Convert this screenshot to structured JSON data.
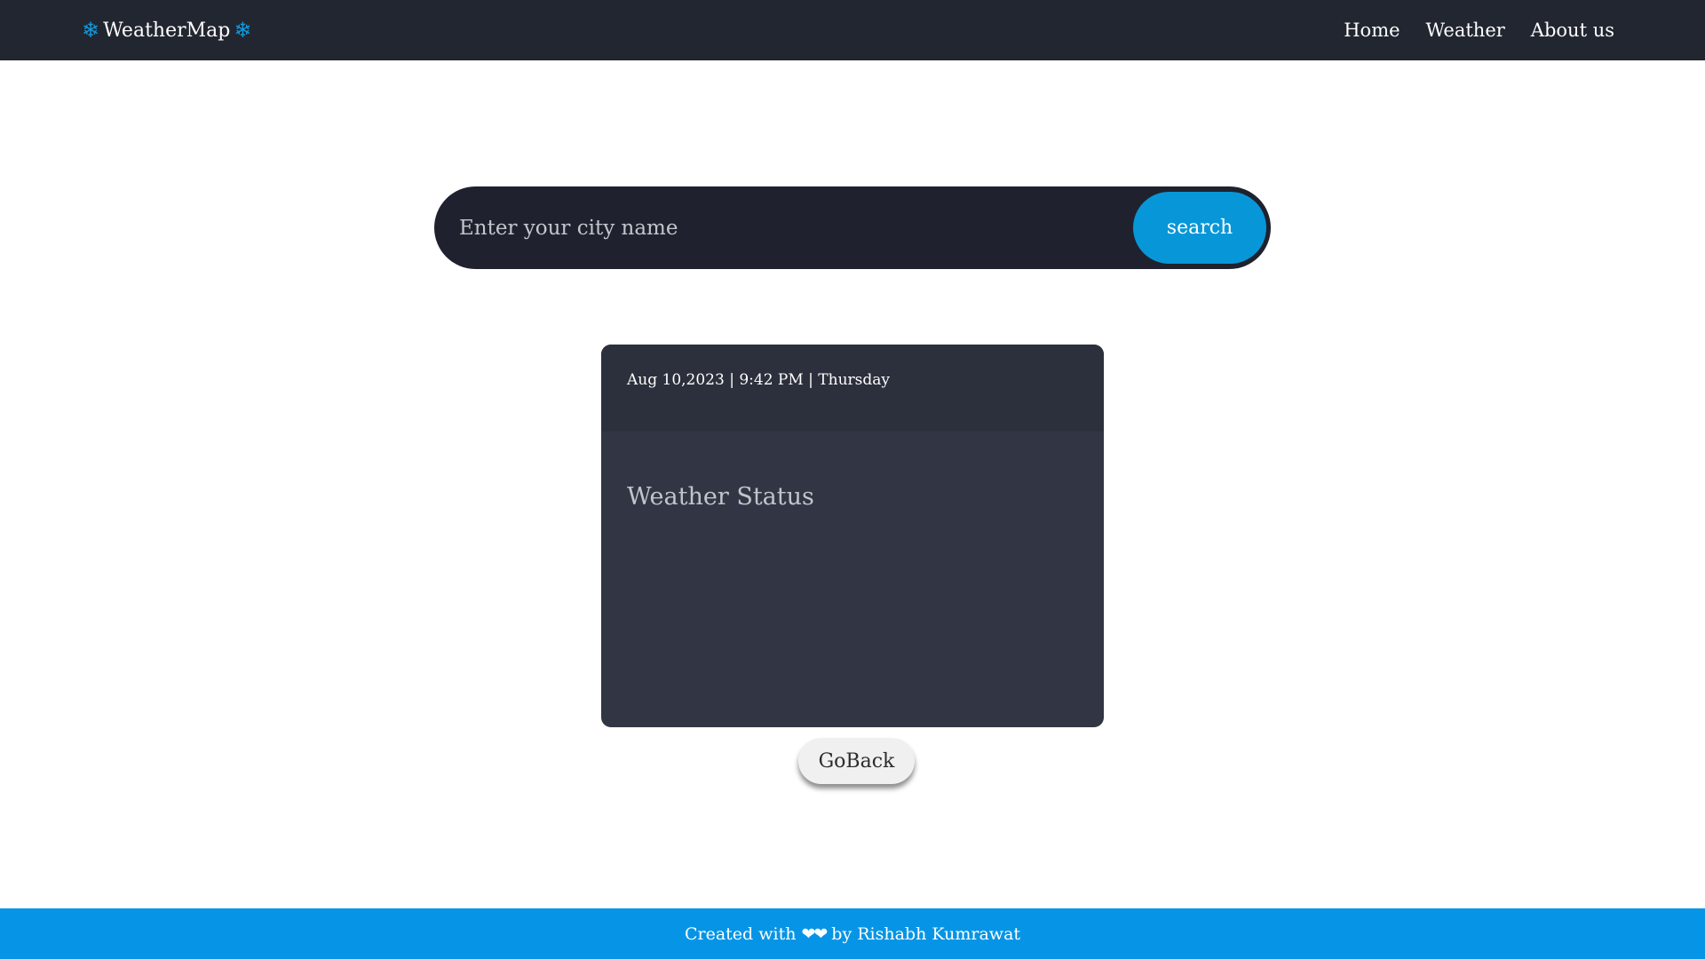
{
  "navbar": {
    "brand": {
      "icon": "snowflake-icon",
      "label": "WeatherMap",
      "icon_color": "#1398dc"
    },
    "links": [
      {
        "label": "Home"
      },
      {
        "label": "Weather"
      },
      {
        "label": "About us"
      }
    ]
  },
  "search": {
    "placeholder": "Enter your city name",
    "value": "",
    "button_label": "search"
  },
  "card": {
    "datetime": "Aug 10,2023 | 9:42 PM | Thursday",
    "status_label": "Weather Status"
  },
  "goback": {
    "label": "GoBack"
  },
  "footer": {
    "prefix": "Created with",
    "icon": "heart-icon",
    "hearts": "❤❤",
    "suffix": "by Rishabh Kumrawat"
  },
  "colors": {
    "navbar_bg": "#212630",
    "accent": "#0797d8",
    "footer_bg": "#0695e6",
    "card_bg": "#323644",
    "search_bg": "#1f222e"
  }
}
